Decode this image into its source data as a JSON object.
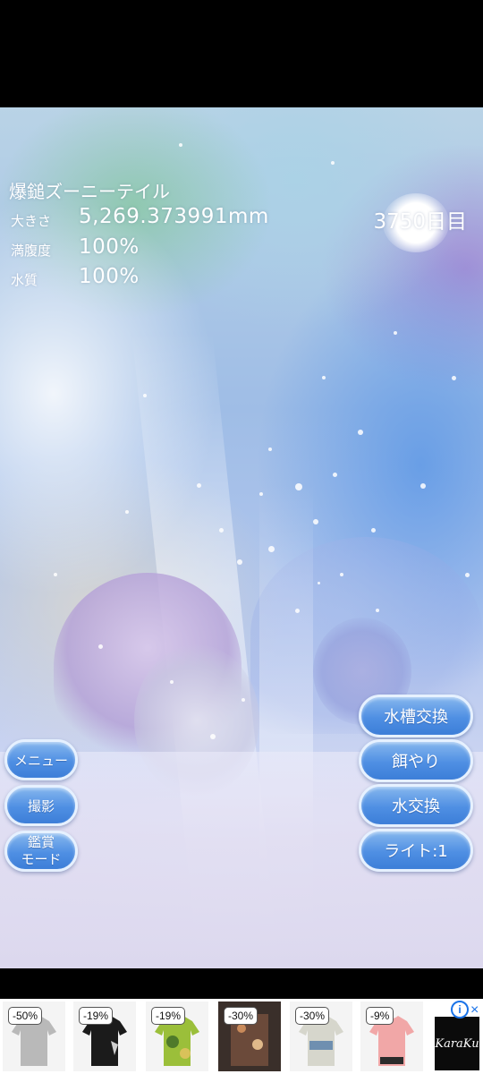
{
  "fish": {
    "name": "爆鎚ズーニーテイル",
    "size_label": "大きさ",
    "size_value": "5,269.373991mm",
    "day_counter": "3750日目",
    "satiety_label": "満腹度",
    "satiety_value": "100%",
    "water_quality_label": "水質",
    "water_quality_value": "100%"
  },
  "left_buttons": {
    "menu": "メニュー",
    "photo": "撮影",
    "viewing_mode": "鑑賞\nモード"
  },
  "right_buttons": {
    "tank_change": "水槽交換",
    "feed": "餌やり",
    "water_change": "水交換",
    "light": "ライト:1"
  },
  "ad": {
    "badges": [
      "-50%",
      "-19%",
      "-19%",
      "-30%",
      "-30%",
      "-9%"
    ],
    "brand": "KaraKu",
    "info_icon": "i",
    "close_icon": "×",
    "colors": {
      "shirt1": "#b9b9b9",
      "shirt2": "#1b1b1b",
      "shirt3": "#9bbf3a",
      "shirt4": "#6b4a3a",
      "shirt5": "#d6d6cc",
      "shirt6": "#f1a7a7"
    }
  }
}
